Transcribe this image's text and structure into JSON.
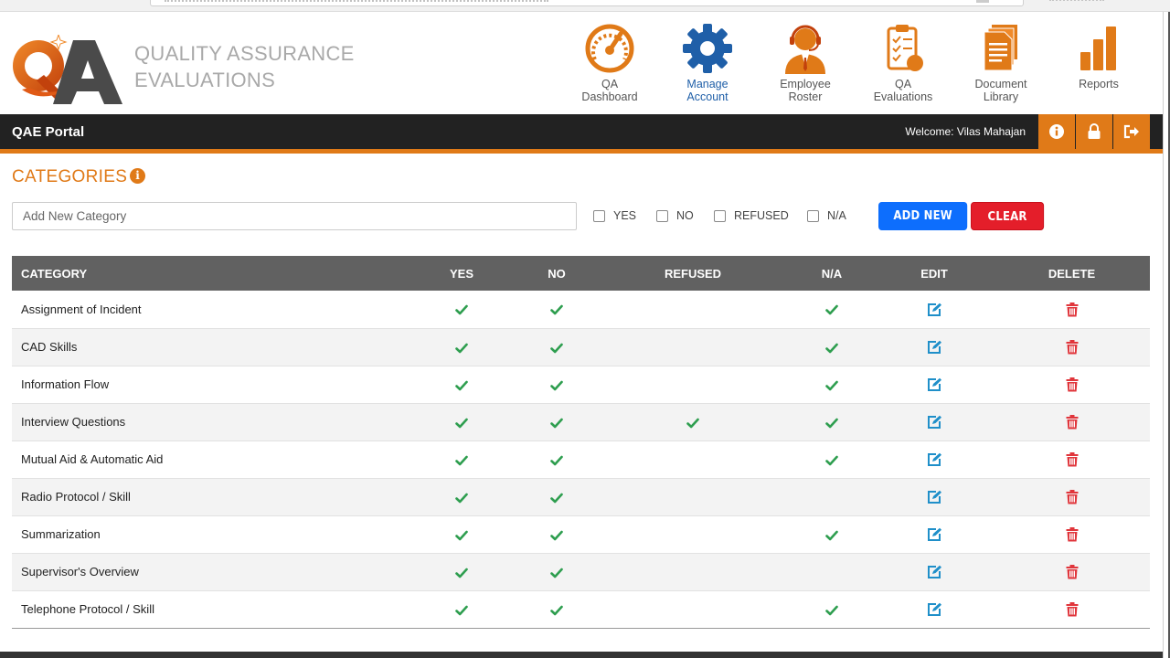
{
  "brand": {
    "logo_text": "QA",
    "name_line1": "QUALITY ASSURANCE",
    "name_line2": "EVALUATIONS"
  },
  "nav": [
    {
      "label_1": "QA",
      "label_2": "Dashboard",
      "icon": "gauge-icon",
      "active": false
    },
    {
      "label_1": "Manage",
      "label_2": "Account",
      "icon": "gear-icon",
      "active": true
    },
    {
      "label_1": "Employee",
      "label_2": "Roster",
      "icon": "headset-operator-icon",
      "active": false
    },
    {
      "label_1": "QA",
      "label_2": "Evaluations",
      "icon": "clipboard-checklist-icon",
      "active": false
    },
    {
      "label_1": "Document",
      "label_2": "Library",
      "icon": "documents-icon",
      "active": false
    },
    {
      "label_1": "Reports",
      "label_2": "",
      "icon": "bar-chart-icon",
      "active": false
    }
  ],
  "topbar": {
    "title": "QAE Portal",
    "welcome": "Welcome: Vilas Mahajan",
    "buttons": [
      "info-icon",
      "lock-icon",
      "sign-out-icon"
    ]
  },
  "page": {
    "title": "CATEGORIES",
    "info_glyph": "i"
  },
  "form": {
    "placeholder": "Add New Category",
    "value": "",
    "checkboxes": [
      "YES",
      "NO",
      "REFUSED",
      "N/A"
    ],
    "add_label": "ADD NEW",
    "clear_label": "CLEAR"
  },
  "table": {
    "headers": [
      "CATEGORY",
      "YES",
      "NO",
      "REFUSED",
      "N/A",
      "EDIT",
      "DELETE"
    ],
    "rows": [
      {
        "name": "Assignment of Incident",
        "yes": true,
        "no": true,
        "refused": false,
        "na": true
      },
      {
        "name": "CAD Skills",
        "yes": true,
        "no": true,
        "refused": false,
        "na": true
      },
      {
        "name": "Information Flow",
        "yes": true,
        "no": true,
        "refused": false,
        "na": true
      },
      {
        "name": "Interview Questions",
        "yes": true,
        "no": true,
        "refused": true,
        "na": true
      },
      {
        "name": "Mutual Aid & Automatic Aid",
        "yes": true,
        "no": true,
        "refused": false,
        "na": true
      },
      {
        "name": "Radio Protocol / Skill",
        "yes": true,
        "no": true,
        "refused": false,
        "na": false
      },
      {
        "name": "Summarization",
        "yes": true,
        "no": true,
        "refused": false,
        "na": true
      },
      {
        "name": "Supervisor's Overview",
        "yes": true,
        "no": true,
        "refused": false,
        "na": false
      },
      {
        "name": "Telephone Protocol / Skill",
        "yes": true,
        "no": true,
        "refused": false,
        "na": true
      }
    ]
  },
  "colors": {
    "accent": "#e07a18",
    "dark_bar": "#222222",
    "table_header": "#616161",
    "check_green": "#2e9e4f",
    "edit_blue": "#1f8fc9",
    "delete_red": "#e0353b",
    "add_blue": "#0d6efd",
    "clear_red": "#e41e2a"
  }
}
